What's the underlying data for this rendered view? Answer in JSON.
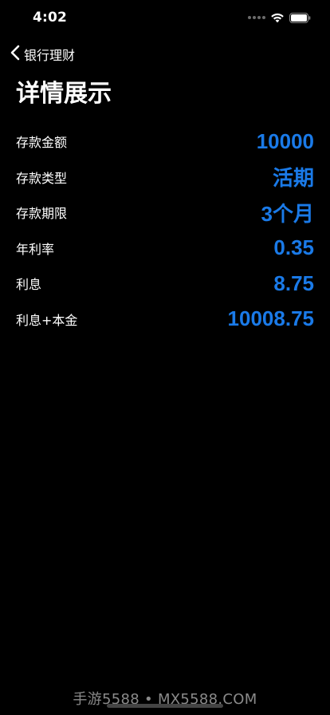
{
  "status_bar": {
    "time": "4:02",
    "icons": [
      "signal-icon",
      "wifi-icon",
      "battery-icon"
    ]
  },
  "nav": {
    "back_label": "银行理财",
    "back_icon": "chevron-left-icon"
  },
  "page": {
    "title": "详情展示"
  },
  "details": [
    {
      "label": "存款金额",
      "value": "10000"
    },
    {
      "label": "存款类型",
      "value": "活期"
    },
    {
      "label": "存款期限",
      "value": "3个月"
    },
    {
      "label": "年利率",
      "value": "0.35"
    },
    {
      "label": "利息",
      "value": "8.75"
    },
    {
      "label": "利息+本金",
      "value": "10008.75"
    }
  ],
  "watermark": "手游5588 • MX5588.COM",
  "colors": {
    "background": "#000000",
    "text": "#ffffff",
    "accent": "#1a7ae8"
  }
}
